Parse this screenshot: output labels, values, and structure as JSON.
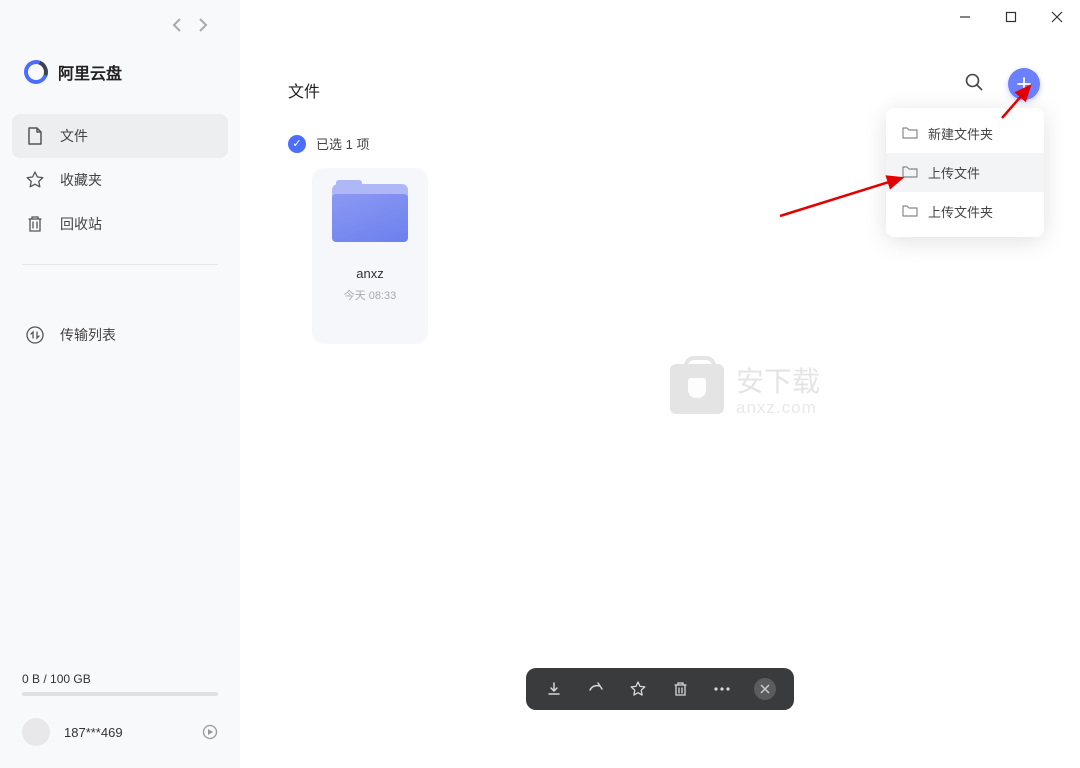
{
  "app": {
    "name": "阿里云盘"
  },
  "sidebar": {
    "nav": [
      {
        "label": "文件",
        "icon": "file"
      },
      {
        "label": "收藏夹",
        "icon": "star"
      },
      {
        "label": "回收站",
        "icon": "trash"
      }
    ],
    "transfer": {
      "label": "传输列表"
    },
    "storage": {
      "text": "0 B / 100 GB"
    },
    "user": {
      "name": "187***469"
    }
  },
  "main": {
    "title": "文件",
    "selection_text": "已选 1 项",
    "folder": {
      "name": "anxz",
      "date": "今天 08:33"
    }
  },
  "dropdown": {
    "items": [
      {
        "label": "新建文件夹"
      },
      {
        "label": "上传文件"
      },
      {
        "label": "上传文件夹"
      }
    ]
  },
  "watermark": {
    "cn": "安下载",
    "en": "anxz.com"
  }
}
